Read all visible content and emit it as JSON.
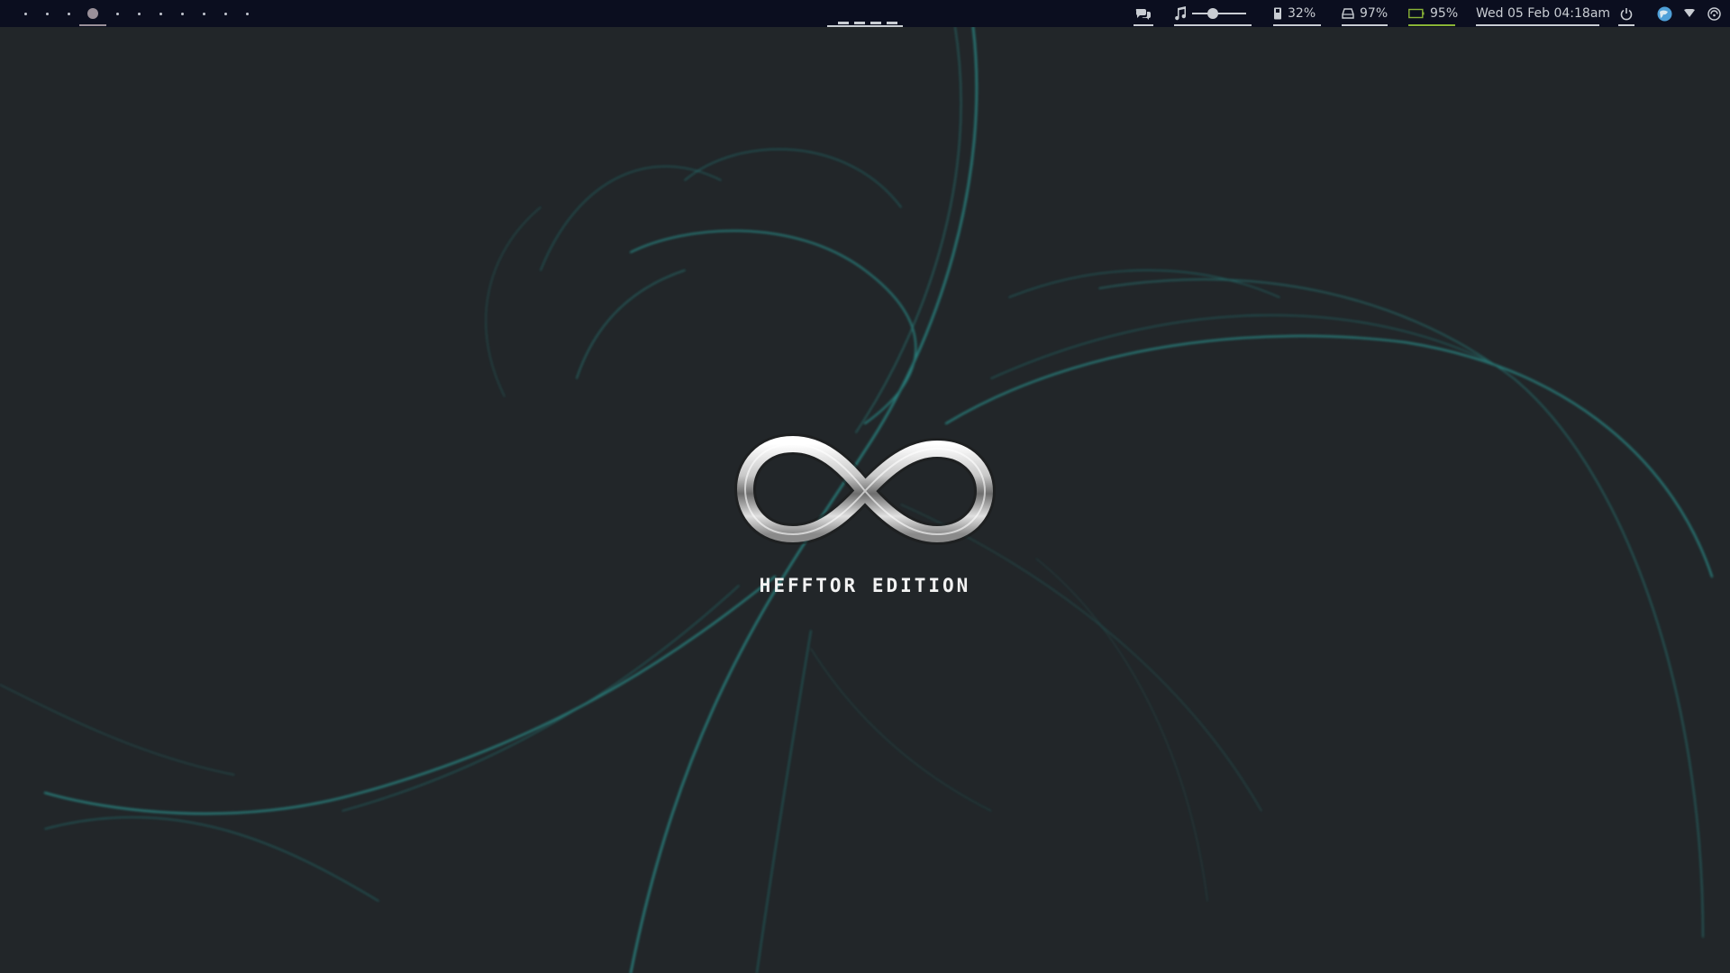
{
  "workspaces": {
    "count": 11,
    "active_index": 3
  },
  "tray": {
    "chat_icon": "chat-bubbles-icon",
    "music_icon": "music-note-icon",
    "volume_level": 0.35,
    "memory_icon": "memory-icon",
    "memory_percent": "32%",
    "disk_icon": "disk-icon",
    "disk_percent": "97%",
    "battery_icon": "battery-icon",
    "battery_percent": "95%",
    "datetime": "Wed 05 Feb 04:18am",
    "power_icon": "power-icon",
    "browser_icon": "globe-app-icon",
    "wifi_icon": "wifi-icon",
    "network_icon": "network-status-icon"
  },
  "desktop": {
    "brand_text": "HEFFTOR EDITION",
    "logo_icon": "infinity-logo-icon"
  },
  "colors": {
    "bar_bg": "#0b0e1f",
    "desktop_bg": "#222629",
    "accent_teal": "#2a8c88",
    "battery_green": "#8ab436",
    "active_workspace": "#9a9099"
  }
}
